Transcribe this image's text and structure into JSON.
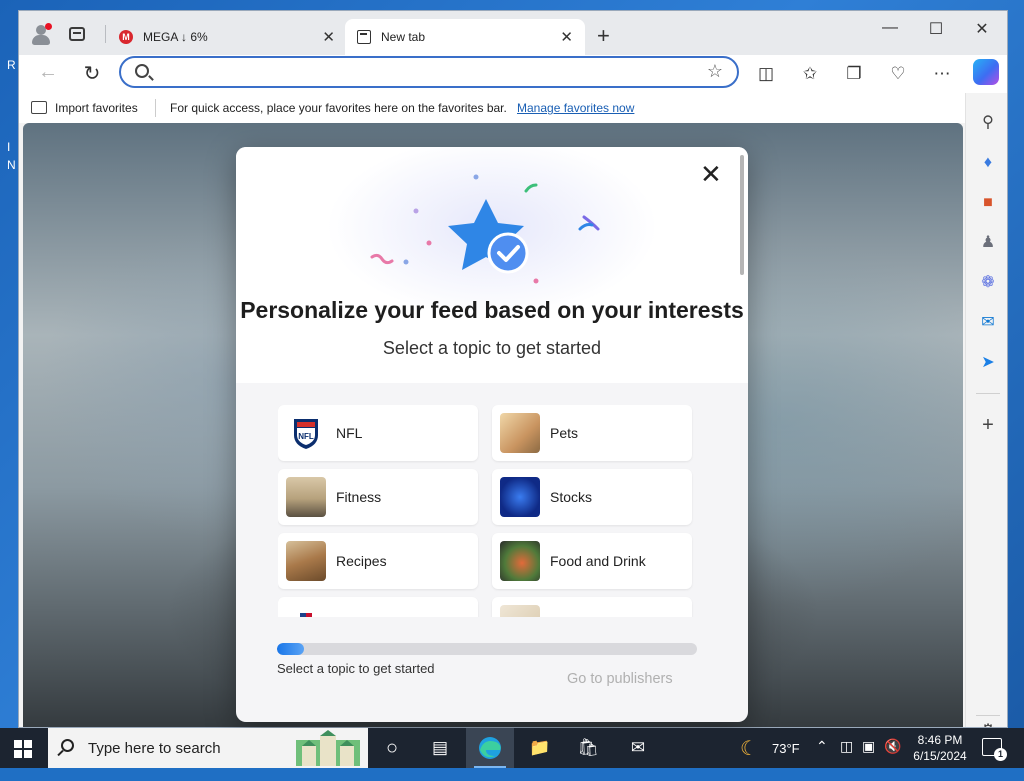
{
  "desktop": {
    "edge_letters": [
      "R",
      "I",
      "N"
    ]
  },
  "browser": {
    "tabs": [
      {
        "title": "MEGA ↓ 6%",
        "favicon": "mega-logo",
        "active": false
      },
      {
        "title": "New tab",
        "favicon": "new-tab-icon",
        "active": true
      }
    ],
    "tab_close_glyph": "✕",
    "new_tab_glyph": "+",
    "window_controls": [
      "—",
      "☐",
      "✕"
    ],
    "address": {
      "value": "",
      "placeholder": ""
    },
    "toolbar_icons": [
      "split-screen-icon",
      "favorites-icon",
      "collections-icon",
      "browser-essentials-icon",
      "more-icon",
      "copilot-icon"
    ],
    "favorites_bar": {
      "import_label": "Import favorites",
      "message": "For quick access, place your favorites here on the favorites bar.",
      "manage_link": "Manage favorites now"
    },
    "sidebar_icons": [
      "search-icon",
      "shopping-icon",
      "tools-icon",
      "games-icon",
      "microsoft-365-icon",
      "outlook-icon",
      "drop-icon",
      "add-icon",
      "settings-icon"
    ]
  },
  "modal": {
    "title": "Personalize your feed based on your interests",
    "subtitle": "Select a topic to get started",
    "topics": [
      {
        "label": "NFL"
      },
      {
        "label": "Pets"
      },
      {
        "label": "Fitness"
      },
      {
        "label": "Stocks"
      },
      {
        "label": "Recipes"
      },
      {
        "label": "Food and Drink"
      },
      {
        "label": ""
      },
      {
        "label": ""
      }
    ],
    "progress_fraction": 0.065,
    "progress_text": "Select a topic to get started",
    "go_button": "Go to publishers",
    "colors": {
      "accent": "#1976e8",
      "disabled_text": "#b0b0b0"
    }
  },
  "taskbar": {
    "search_placeholder": "Type here to search",
    "weather": "73°F",
    "time": "8:46 PM",
    "date": "6/15/2024",
    "notification_count": "1",
    "background": "#1c2430"
  }
}
